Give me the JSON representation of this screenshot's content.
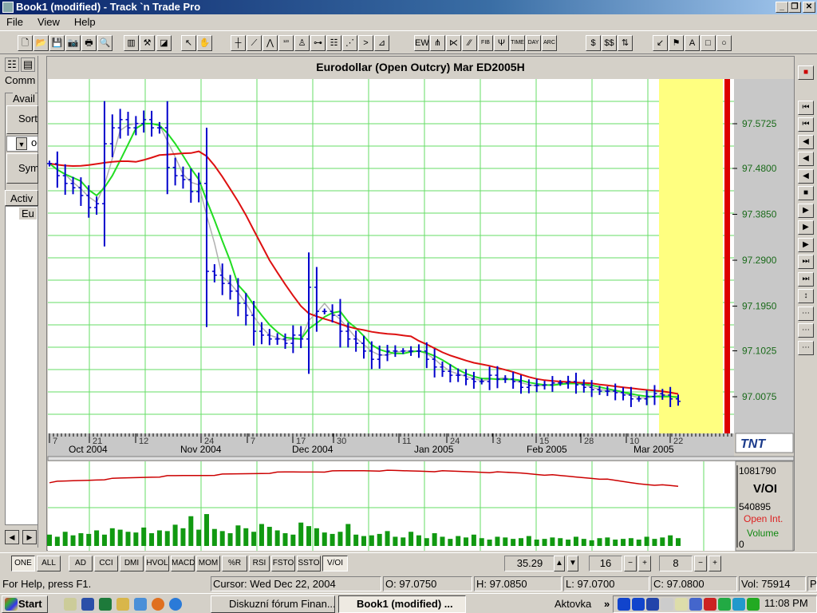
{
  "window": {
    "title": "Book1 (modified) - Track `n Trade Pro",
    "controls": [
      "_",
      "❐",
      "✕"
    ]
  },
  "menu": [
    "File",
    "View",
    "Help"
  ],
  "toolbar": {
    "buttons": [
      {
        "name": "new-icon",
        "g": "🗋"
      },
      {
        "name": "open-icon",
        "g": "📂"
      },
      {
        "name": "save-icon",
        "g": "💾"
      },
      {
        "name": "camera-icon",
        "g": "📷"
      },
      {
        "name": "print-icon",
        "g": "🖶"
      },
      {
        "name": "print-preview-icon",
        "g": "🔍"
      },
      {
        "name": "columns-icon",
        "g": "▥"
      },
      {
        "name": "tools-icon",
        "g": "⚒"
      },
      {
        "name": "chart-red-icon",
        "g": "◪"
      },
      {
        "name": "pointer-icon",
        "g": "↖"
      },
      {
        "name": "hand-icon",
        "g": "✋"
      },
      {
        "name": "crosshair-icon",
        "g": "┼"
      },
      {
        "name": "trendline-icon",
        "g": "⟋"
      },
      {
        "name": "wave-icon",
        "g": "⋀"
      },
      {
        "name": "123-icon",
        "g": "¹²³"
      },
      {
        "name": "andrews-icon",
        "g": "♙"
      },
      {
        "name": "channel-icon",
        "g": "⊶"
      },
      {
        "name": "parallel-icon",
        "g": "☷"
      },
      {
        "name": "fan-icon",
        "g": "⋰"
      },
      {
        "name": "angle-icon",
        "g": ">"
      },
      {
        "name": "gann-icon",
        "g": "⊿"
      },
      {
        "name": "elliott-wave-icon",
        "g": "EW"
      },
      {
        "name": "pitchfork-icon",
        "g": "⋔"
      },
      {
        "name": "gann-fan-icon",
        "g": "⋉"
      },
      {
        "name": "speed-lines-icon",
        "g": "⁄⁄"
      },
      {
        "name": "fib-icon",
        "g": "FIB"
      },
      {
        "name": "fib-fan-icon",
        "g": "Ψ"
      },
      {
        "name": "time-icon",
        "g": "TIME"
      },
      {
        "name": "day-icon",
        "g": "DAY"
      },
      {
        "name": "arc-icon",
        "g": "ARC"
      },
      {
        "name": "dollar-icon",
        "g": "$"
      },
      {
        "name": "dollar-swap-icon",
        "g": "$$"
      },
      {
        "name": "buy-sell-icon",
        "g": "⇅"
      },
      {
        "name": "arrow-icon",
        "g": "↙"
      },
      {
        "name": "flag-icon",
        "g": "⚑"
      },
      {
        "name": "text-icon",
        "g": "A"
      },
      {
        "name": "rectangle-icon",
        "g": "□"
      },
      {
        "name": "ellipse-icon",
        "g": "○"
      }
    ]
  },
  "left_panel": {
    "tabs": [
      "☷",
      "▤"
    ],
    "commodities_label": "Comm",
    "available_label": "Avail",
    "sort_label": "Sort",
    "combo_value": "oc",
    "symbol_label": "Sym",
    "active_label": "Activ",
    "active_item": "Eu",
    "scroll_left": "◀",
    "scroll_right": "▶"
  },
  "chart_data": {
    "type": "bar",
    "title": "Eurodollar (Open Outcry) Mar ED2005H",
    "y_ticks": [
      "97.5725",
      "97.4800",
      "97.3850",
      "97.2900",
      "97.1950",
      "97.1025",
      "97.0075"
    ],
    "ylim": [
      96.94,
      97.65
    ],
    "x_day_ticks": [
      "7",
      "21",
      "12",
      "24",
      "7",
      "17",
      "30",
      "11",
      "24",
      "3",
      "15",
      "28",
      "10",
      "22"
    ],
    "x_month_labels": [
      "Oct 2004",
      "Nov 2004",
      "Dec 2004",
      "Jan 2005",
      "Feb 2005",
      "Mar 2005"
    ],
    "closes": [
      97.49,
      97.465,
      97.449,
      97.44,
      97.424,
      97.399,
      97.407,
      97.531,
      97.564,
      97.581,
      97.564,
      97.573,
      97.581,
      97.564,
      97.564,
      97.482,
      97.465,
      97.457,
      97.432,
      97.449,
      97.267,
      97.259,
      97.242,
      97.226,
      97.201,
      97.176,
      97.143,
      97.135,
      97.127,
      97.127,
      97.118,
      97.135,
      97.127,
      97.234,
      97.184,
      97.184,
      97.176,
      97.143,
      97.127,
      97.118,
      97.102,
      97.085,
      97.094,
      97.102,
      97.102,
      97.102,
      97.102,
      97.102,
      97.085,
      97.069,
      97.06,
      97.052,
      97.052,
      97.044,
      97.039,
      97.039,
      97.052,
      97.044,
      97.044,
      97.039,
      97.027,
      97.031,
      97.031,
      97.032,
      97.036,
      97.036,
      97.039,
      97.032,
      97.027,
      97.022,
      97.019,
      97.019,
      97.016,
      97.011,
      97.003,
      97.003,
      97.008,
      97.014,
      97.011,
      97.003,
      96.998
    ],
    "moving_averages": [
      {
        "color": "#b0b0b0"
      },
      {
        "color": "#22dd22"
      },
      {
        "color": "#dd1111"
      }
    ],
    "colors": {
      "bars": "#0000cc",
      "grid": "#66dd66",
      "future_zone": "#ffff80",
      "expiry_marker": "#dd0000"
    },
    "lower_panel": {
      "label": "V/OI",
      "scale_top": "1081790",
      "scale_mid": "540895",
      "scale_zero": "0",
      "legend_oi": "Open Int.",
      "legend_volume": "Volume",
      "ymax": 1081790,
      "open_interest": [
        900000,
        930000,
        960000,
        985000,
        1000000,
        1020000,
        1040000,
        1050000,
        1065000,
        1060000,
        1055000,
        1045000,
        1030000,
        990000,
        950000,
        880000,
        840000
      ],
      "volume": [
        160000,
        130000,
        200000,
        150000,
        180000,
        170000,
        220000,
        160000,
        250000,
        230000,
        200000,
        190000,
        260000,
        180000,
        220000,
        210000,
        300000,
        250000,
        420000,
        230000,
        450000,
        240000,
        210000,
        180000,
        290000,
        250000,
        200000,
        310000,
        270000,
        220000,
        180000,
        160000,
        330000,
        280000,
        250000,
        190000,
        170000,
        200000,
        310000,
        160000,
        140000,
        150000,
        170000,
        210000,
        130000,
        120000,
        200000,
        150000,
        110000,
        180000,
        130000,
        100000,
        140000,
        120000,
        160000,
        110000,
        90000,
        130000,
        120000,
        100000,
        110000,
        140000,
        90000,
        100000,
        120000,
        110000,
        90000,
        130000,
        100000,
        80000,
        110000,
        120000,
        90000,
        100000,
        110000,
        90000,
        130000,
        100000,
        120000,
        150000,
        110000
      ]
    },
    "logo": "TNT"
  },
  "right_toolbar": [
    "■",
    "⏮",
    "⏮",
    "◀",
    "◀",
    "◀",
    "■",
    "▶",
    "▶",
    "▶",
    "⏭",
    "⏭",
    "↕",
    "⋯",
    "⋯",
    "⋯"
  ],
  "indicator_bar": {
    "buttons": [
      "ONE",
      "ALL",
      "AD",
      "CCI",
      "DMI",
      "HVOL",
      "MACD",
      "MOM",
      "%R",
      "RSI",
      "FSTO",
      "SSTO",
      "V/OI"
    ],
    "active": [
      "ONE",
      "V/OI"
    ],
    "value": "35.29",
    "period1": "16",
    "period2": "8",
    "up": "▲",
    "down": "▼",
    "minus": "−",
    "plus": "+"
  },
  "status": {
    "help": "For Help, press F1.",
    "cursor": "Cursor: Wed Dec 22, 2004",
    "open": "O: 97.0750",
    "high": "H: 97.0850",
    "low": "L: 97.0700",
    "close": "C: 97.0800",
    "volume": "Vol: 75914",
    "extra": "P:"
  },
  "taskbar": {
    "start": "Start",
    "tasks": [
      "Diskuzní fórum Finan...",
      "Book1 (modified) ..."
    ],
    "toolbar_label": "Aktovka",
    "chevron": "»",
    "clock": "11:08 PM"
  }
}
